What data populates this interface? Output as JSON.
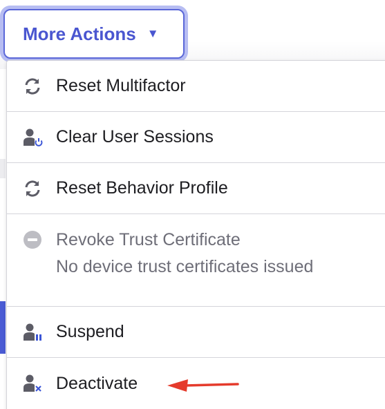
{
  "button": {
    "label": "More Actions",
    "caret": "▼"
  },
  "menu": {
    "items": [
      {
        "label": "Reset Multifactor",
        "icon": "refresh-icon",
        "disabled": false
      },
      {
        "label": "Clear User Sessions",
        "icon": "user-power-icon",
        "disabled": false
      },
      {
        "label": "Reset Behavior Profile",
        "icon": "refresh-icon",
        "disabled": false
      },
      {
        "label": "Revoke Trust Certificate",
        "icon": "minus-circle-icon",
        "disabled": true,
        "description": "No device trust certificates issued"
      },
      {
        "label": "Suspend",
        "icon": "user-pause-icon",
        "disabled": false
      },
      {
        "label": "Deactivate",
        "icon": "user-x-icon",
        "disabled": false
      }
    ]
  },
  "colors": {
    "accent": "#4a56d0",
    "focus_ring": "#b7bdf2",
    "icon_gray": "#5c5c66",
    "icon_blue": "#3b55d6",
    "annotation_red": "#e53b2c"
  }
}
